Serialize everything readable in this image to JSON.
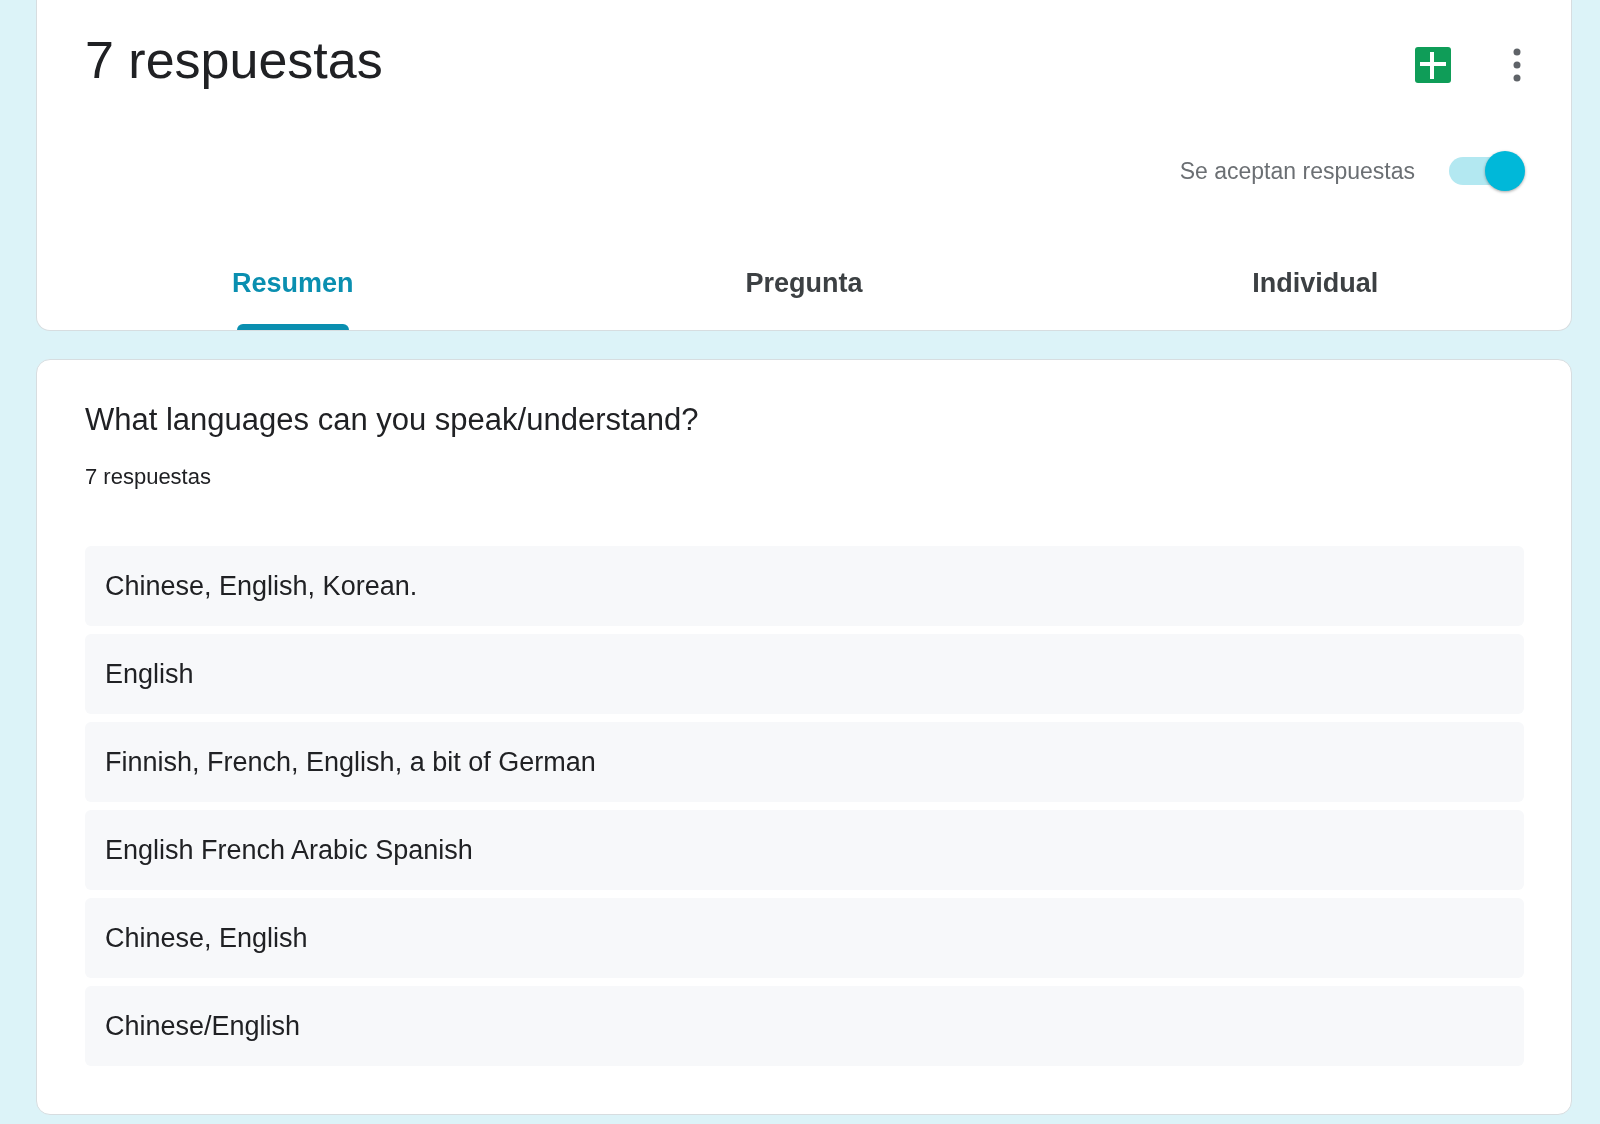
{
  "header": {
    "title": "7 respuestas",
    "accepting": {
      "label": "Se aceptan respuestas",
      "on": true
    }
  },
  "tabs": [
    {
      "label": "Resumen",
      "selected": true
    },
    {
      "label": "Pregunta",
      "selected": false
    },
    {
      "label": "Individual",
      "selected": false
    }
  ],
  "question": {
    "title": "What languages can you speak/understand?",
    "count": "7 respuestas",
    "answers": [
      "Chinese, English, Korean.",
      "English",
      "Finnish, French, English, a bit of German",
      "English French Arabic Spanish",
      "Chinese, English",
      "Chinese/English"
    ]
  }
}
